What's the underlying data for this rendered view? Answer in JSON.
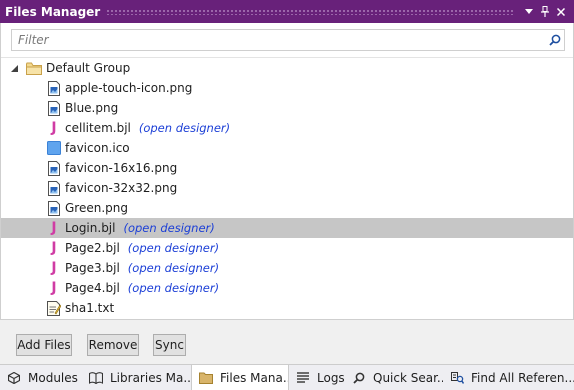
{
  "titlebar": {
    "title": "Files Manager",
    "buttons": [
      "dropdown-arrow-icon",
      "pin-icon",
      "close-icon"
    ]
  },
  "filter": {
    "placeholder": "Filter",
    "value": ""
  },
  "tree": {
    "group": {
      "label": "Default Group",
      "expanded": true,
      "icon": "folder-icon"
    },
    "items": [
      {
        "name": "apple-touch-icon.png",
        "icon": "image-file-icon",
        "link": ""
      },
      {
        "name": "Blue.png",
        "icon": "image-file-icon",
        "link": ""
      },
      {
        "name": "cellitem.bjl",
        "icon": "designer-file-icon",
        "link": "(open designer)"
      },
      {
        "name": "favicon.ico",
        "icon": "ico-file-icon",
        "link": ""
      },
      {
        "name": "favicon-16x16.png",
        "icon": "image-file-icon",
        "link": ""
      },
      {
        "name": "favicon-32x32.png",
        "icon": "image-file-icon",
        "link": ""
      },
      {
        "name": "Green.png",
        "icon": "image-file-icon",
        "link": ""
      },
      {
        "name": "Login.bjl",
        "icon": "designer-file-icon",
        "link": "(open designer)",
        "selected": true
      },
      {
        "name": "Page2.bjl",
        "icon": "designer-file-icon",
        "link": "(open designer)"
      },
      {
        "name": "Page3.bjl",
        "icon": "designer-file-icon",
        "link": "(open designer)"
      },
      {
        "name": "Page4.bjl",
        "icon": "designer-file-icon",
        "link": "(open designer)"
      },
      {
        "name": "sha1.txt",
        "icon": "text-file-icon",
        "link": ""
      }
    ]
  },
  "buttons": {
    "add_files": "Add Files",
    "remove": "Remove",
    "sync": "Sync"
  },
  "tabs": [
    {
      "label": "Modules",
      "icon": "modules-icon"
    },
    {
      "label": "Libraries Ma...",
      "icon": "book-icon"
    },
    {
      "label": "Files Mana...",
      "icon": "folder-icon",
      "active": true
    },
    {
      "label": "Logs",
      "icon": "logs-icon"
    },
    {
      "label": "Quick Sear...",
      "icon": "magnifier-icon"
    },
    {
      "label": "Find All Referen...",
      "icon": "find-references-icon"
    }
  ],
  "colors": {
    "titlebar": "#68217a",
    "selection": "#c6c6c6",
    "link": "#1c3fd6",
    "designer_icon": "#d03ca4"
  }
}
